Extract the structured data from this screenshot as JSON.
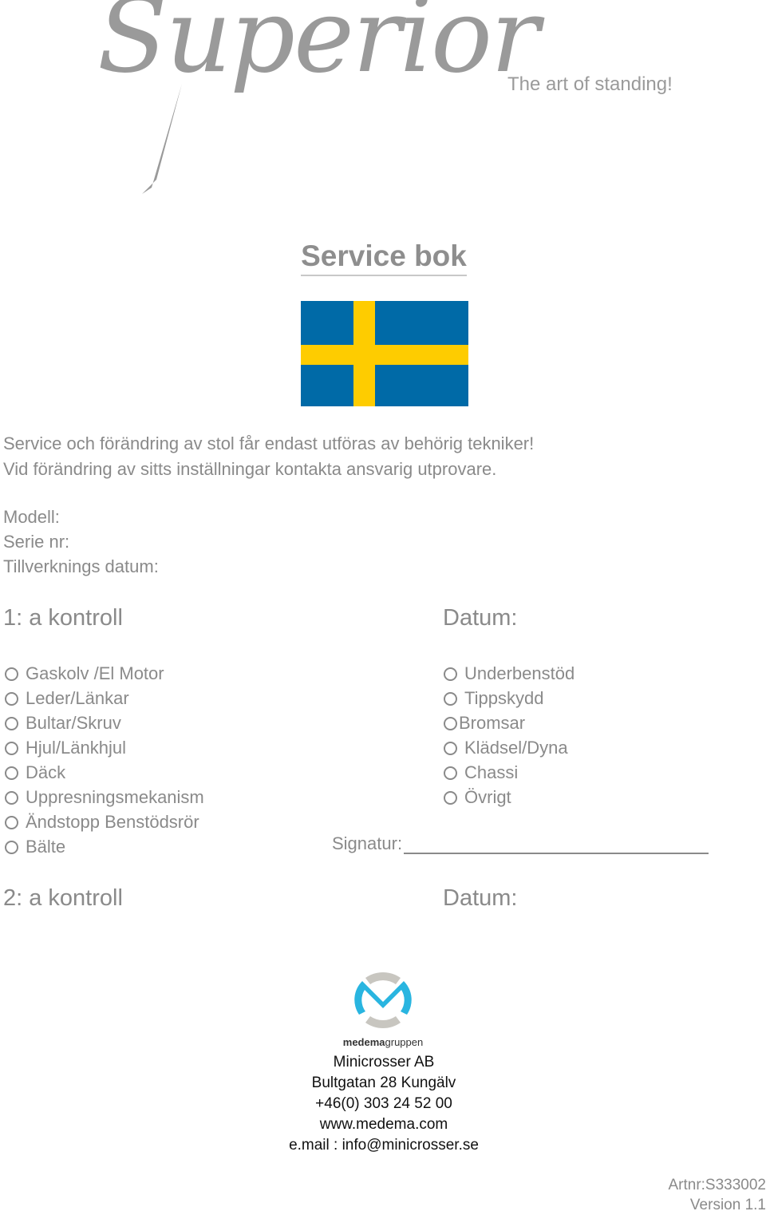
{
  "header": {
    "brand": "Superior",
    "tagline": "The art of standing!"
  },
  "title": "Service bok",
  "flag": {
    "name": "Sweden",
    "colors": {
      "blue": "#006aa7",
      "yellow": "#fecc00"
    }
  },
  "notice": [
    "Service och förändring av stol får endast utföras av behörig tekniker!",
    "Vid förändring av sitts inställningar kontakta ansvarig utprovare."
  ],
  "fields": [
    "Modell:",
    "Serie nr:",
    "Tillverknings datum:"
  ],
  "control1": {
    "heading": "1: a kontroll",
    "date_label": "Datum:",
    "left_items": [
      "Gaskolv /El Motor",
      "Leder/Länkar",
      "Bultar/Skruv",
      "Hjul/Länkhjul",
      "Däck",
      "Uppresningsmekanism",
      "Ändstopp Benstödsrör",
      "Bälte"
    ],
    "right_items": [
      "Underbenstöd",
      "Tippskydd",
      "Bromsar",
      "Klädsel/Dyna",
      "Chassi",
      "Övrigt"
    ],
    "signature_label": "Signatur:"
  },
  "control2": {
    "heading": "2: a kontroll",
    "date_label": "Datum:"
  },
  "logo": {
    "bold": "medema",
    "light": "gruppen",
    "colors": {
      "m": "#29b5e0",
      "ring": "#c8c6c0"
    }
  },
  "contact": {
    "company": "Minicrosser AB",
    "address": "Bultgatan 28 Kungälv",
    "phone": "+46(0) 303 24 52 00",
    "web": "www.medema.com",
    "email": "e.mail : info@minicrosser.se"
  },
  "footer": {
    "artnr": "Artnr:S333002",
    "version": "Version 1.1"
  }
}
